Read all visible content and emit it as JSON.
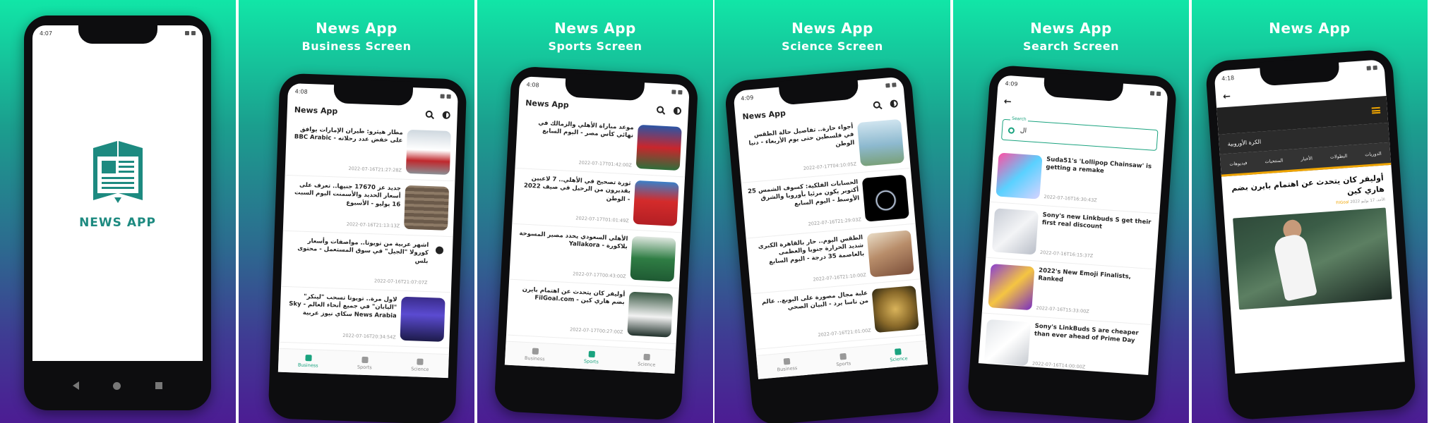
{
  "panels": [
    {
      "title": "",
      "subtitle": ""
    },
    {
      "title": "News App",
      "subtitle": "Business Screen"
    },
    {
      "title": "News App",
      "subtitle": "Sports Screen"
    },
    {
      "title": "News App",
      "subtitle": "Science Screen"
    },
    {
      "title": "News App",
      "subtitle": "Search Screen"
    },
    {
      "title": "News App",
      "subtitle": ""
    }
  ],
  "splash": {
    "time": "4:07",
    "logo_text": "NEWS APP"
  },
  "business": {
    "time": "4:08",
    "app_title": "News App",
    "articles": [
      {
        "title": "مطار هيثرو: طيران الإمارات يوافق على خفض عدد رحلاته - BBC Arabic",
        "date": "2022-07-16T21:27:28Z"
      },
      {
        "title": "جديد عز 17670 جنيها.. تعرف على أسعار الحديد والأسمنت اليوم السبت 16 يوليو - الأسبوع",
        "date": "2022-07-16T21:13:13Z"
      },
      {
        "title": "اشهر عربية من تويوتا.. مواصفات وأسعار كورولا \"الجيل\" في سوق المستعمل - محتوى بلس",
        "date": "2022-07-16T21:07:07Z"
      },
      {
        "title": "لاول مرة.. تويوتا تسحب \"لينكر\" \"اليابان\" في جميع أنحاء العالم - Sky News Arabia سكاي نيوز عربية",
        "date": "2022-07-16T20:34:54Z"
      }
    ],
    "nav": [
      "Business",
      "Sports",
      "Science"
    ]
  },
  "sports": {
    "time": "4:08",
    "app_title": "News App",
    "articles": [
      {
        "title": "موعد مباراة الأهلي والزمالك في نهائي كأس مصر - اليوم السابع",
        "date": "2022-07-17T01:42:00Z"
      },
      {
        "title": "ثورة تصحيح في الأهلي.. 7 لاعبين بقديرون من الرحيل في صيف 2022 - الوطن",
        "date": "2022-07-17T01:01:49Z"
      },
      {
        "title": "الأهلي السعودي يحدد مصير المسوحة بلاكورة - Yallakora",
        "date": "2022-07-17T00:43:00Z"
      },
      {
        "title": "أوليفر كان يتحدث عن اهتمام بايرن بضم هاري كين - FilGoal.com",
        "date": "2022-07-17T00:27:00Z"
      }
    ],
    "nav": [
      "Business",
      "Sports",
      "Science"
    ]
  },
  "science": {
    "time": "4:09",
    "app_title": "News App",
    "articles": [
      {
        "title": "أجواء حارة.. تفاصيل حالة الطقس في فلسطين حتى يوم الأربعاء - دنيا الوطن",
        "date": "2022-07-17T04:10:05Z"
      },
      {
        "title": "الحسابات الفلكية: كسوف الشمس 25 أكتوبر يكون مرئيا بأوروبا والشرق الأوسط - اليوم السابع",
        "date": "2022-07-16T21:29:03Z"
      },
      {
        "title": "الطقس اليوم.. حار بالقاهرة الكبرى شديد الحرارة جنوبا والعظمى بالعاصمة 35 درجة - اليوم السابع",
        "date": "2022-07-16T21:10:00Z"
      },
      {
        "title": "علبة مجال مصورة على البوبع.. عالم من ناسا يرد - البيان الصحي",
        "date": "2022-07-16T21:01:00Z"
      }
    ],
    "nav": [
      "Business",
      "Sports",
      "Science"
    ]
  },
  "search": {
    "time": "4:09",
    "label": "Search",
    "query": "ال",
    "articles": [
      {
        "title": "Suda51's 'Lollipop Chainsaw' is getting a remake",
        "date": "2022-07-16T16:30:43Z"
      },
      {
        "title": "Sony's new Linkbuds S get their first real discount",
        "date": "2022-07-16T16:15:37Z"
      },
      {
        "title": "2022's New Emoji Finalists, Ranked",
        "date": "2022-07-16T15:33:00Z"
      },
      {
        "title": "Sony's LinkBuds S are cheaper than ever ahead of Prime Day",
        "date": "2022-07-16T14:00:00Z"
      }
    ]
  },
  "web": {
    "time": "4:18",
    "category": "الكرة الأوروبية",
    "tabs": [
      "الدوريات",
      "البطولات",
      "الأخبار",
      "المنتخبات",
      "فيديوهات"
    ],
    "title": "أوليفر كان يتحدث عن اهتمام بايرن بضم هاري كين",
    "meta_date": "الأحد، 17 يوليو 2022",
    "meta_source": "FilGoal"
  },
  "colors": {
    "accent": "#1aa37f",
    "splash_brand": "#1d8a80",
    "web_accent": "#f0a500"
  }
}
